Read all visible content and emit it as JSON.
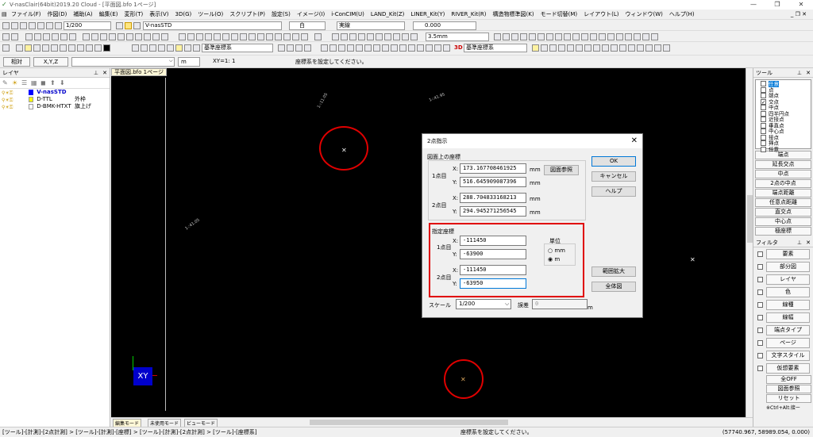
{
  "window": {
    "title": "V-nasClair(64bit)2019.20 Cloud - [平面図.bfo 1ページ]"
  },
  "menu": [
    "ファイル(F)",
    "作図(D)",
    "補助(A)",
    "編集(E)",
    "変形(T)",
    "表示(V)",
    "3D(G)",
    "ツール(O)",
    "スクリプト(P)",
    "設定(S)",
    "イメージ(I)",
    "i-ConCIM(U)",
    "LAND_Kit(Z)",
    "LINER_Kit(Y)",
    "RIVER_Kit(R)",
    "構造物標準図(K)",
    "モード切替(M)",
    "レイアウト(L)",
    "ウィンドウ(W)",
    "ヘルプ(H)"
  ],
  "toolbar1": {
    "scale": "1/200",
    "layer": "V-nasSTD",
    "color": "白",
    "linetype": "実線",
    "width": "0.000"
  },
  "toolbar2": {
    "pen": "3.5mm"
  },
  "toolbar3": {
    "coord_left": "基準座標系",
    "coord_right": "基準座標系",
    "label_3d": "3D"
  },
  "inputbar": {
    "mode": "相対",
    "coord": "X,Y,Z",
    "unit": "m",
    "xy": "XY=1: 1",
    "message": "座標系を設定してください。"
  },
  "layer_panel": {
    "title": "レイヤ",
    "items": [
      {
        "name": "V-nasSTD",
        "comment": ""
      },
      {
        "name": "D-TTL",
        "comment": "外枠"
      },
      {
        "name": "D-BMK-HTXT",
        "comment": "旗上げ"
      }
    ]
  },
  "canvas": {
    "tab": "平面図.bfo 1ページ",
    "labels": [
      "1-:11.05",
      "1-:41.95",
      "1-:41.05"
    ],
    "ucs_label": "XY",
    "mode_tabs": [
      "編集モード",
      "未使用モード",
      "ビューモード"
    ]
  },
  "dialog": {
    "title": "2点指示",
    "section1": "図面上の座標",
    "section2": "指定座標",
    "point1": "1点目",
    "point2": "2点目",
    "x": "X:",
    "y": "Y:",
    "mm": "mm",
    "m": "m",
    "p1x": "173.167708461925",
    "p1y": "516.645909087396",
    "p2x": "288.704833168213",
    "p2y": "294.945271256545",
    "s1x": "-111450",
    "s1y": "-63900",
    "s2x": "-111450",
    "s2y": "-63950",
    "unit_label": "単位",
    "unit_options": [
      "mm",
      "m"
    ],
    "unit_selected": "m",
    "scale_label": "スケール",
    "scale_value": "1/200",
    "error_label": "誤差",
    "error_value": "0",
    "error_unit": "m",
    "buttons": {
      "ok": "OK",
      "cancel": "キャンセル",
      "help": "ヘルプ",
      "ref": "図面参照",
      "zoom": "範囲拡大",
      "all": "全体図"
    },
    "highlight_color": "#e00000"
  },
  "tool_panel": {
    "title": "ツール",
    "snaps": [
      {
        "label": "任意",
        "checked": false
      },
      {
        "label": "点",
        "checked": false
      },
      {
        "label": "端点",
        "checked": false
      },
      {
        "label": "交点",
        "checked": true
      },
      {
        "label": "中点",
        "checked": false
      },
      {
        "label": "四半円点",
        "checked": false
      },
      {
        "label": "近接点",
        "checked": false
      },
      {
        "label": "垂直点",
        "checked": false
      },
      {
        "label": "中心点",
        "checked": false
      },
      {
        "label": "接点",
        "checked": false
      },
      {
        "label": "挿点",
        "checked": false
      },
      {
        "label": "任意",
        "checked": false
      }
    ],
    "buttons": [
      "端点",
      "延長交点",
      "中点",
      "2点の中点",
      "端点距離",
      "任意点距離",
      "直交点",
      "中心点",
      "極座標"
    ]
  },
  "filter_panel": {
    "title": "フィルタ",
    "items": [
      "要素",
      "部分図",
      "レイヤ",
      "色",
      "線種",
      "線幅",
      "端点タイプ",
      "ページ",
      "文字スタイル",
      "仮想要素"
    ],
    "buttons": [
      "全OFF",
      "図面参照",
      "リセット"
    ],
    "footer": "※Ctrl+Alt:接ー"
  },
  "statusbar": {
    "path": "[ツール]-[計測]-[2点計測] > [ツール]-[計測]-[座標] > [ツール]-[計測]-[2点計測] > [ツール]-[座標系]",
    "message": "座標系を設定してください。",
    "coords": "(57740.967, 58989.054, 0.000)"
  }
}
